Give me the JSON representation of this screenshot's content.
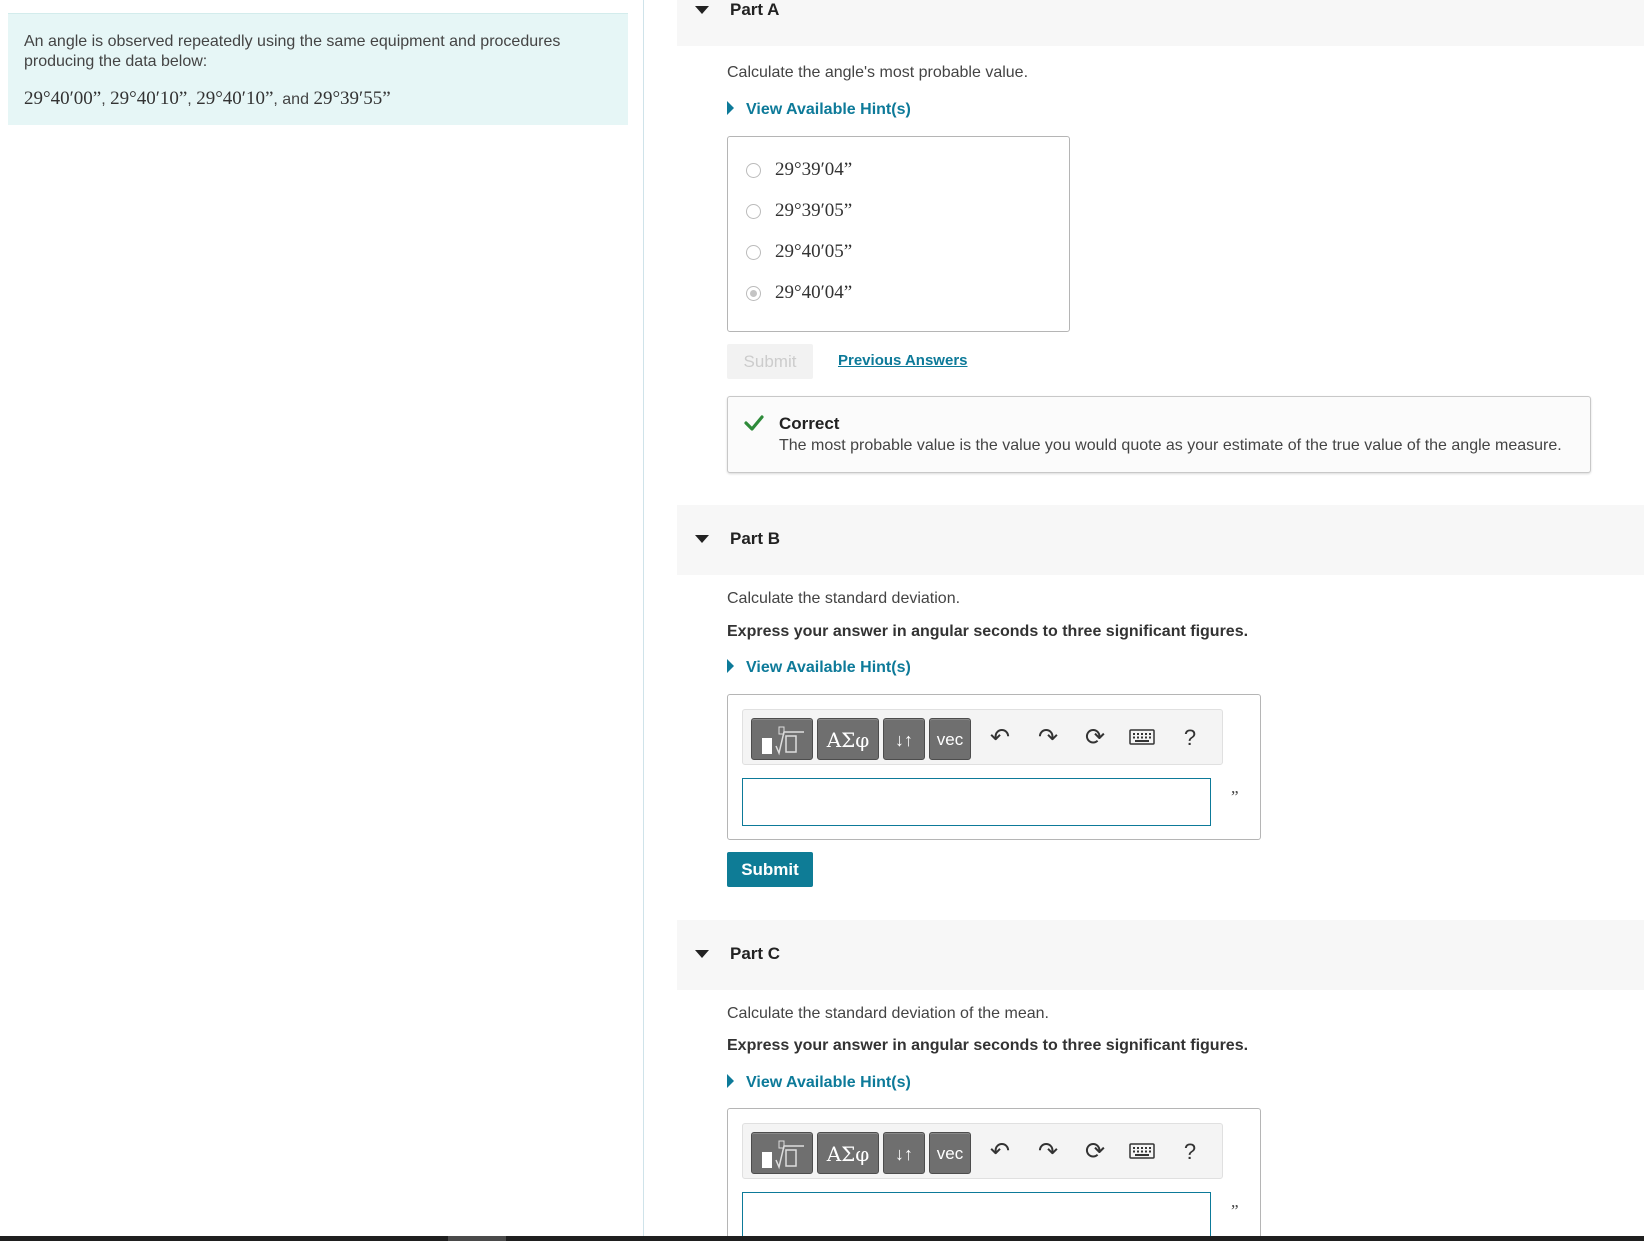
{
  "problem": {
    "intro": "An angle is observed repeatedly using the same equipment and procedures producing the data below:",
    "data_values": [
      "29°40′00”",
      "29°40′10”",
      "29°40′10”",
      "29°39′55”"
    ],
    "sep": ",",
    "and": "and"
  },
  "partA": {
    "title": "Part A",
    "prompt": "Calculate the angle's most probable value.",
    "hint_label": "View Available Hint(s)",
    "choices": [
      {
        "label": "29°39′04”",
        "selected": false
      },
      {
        "label": "29°39′05”",
        "selected": false
      },
      {
        "label": "29°40′05”",
        "selected": false
      },
      {
        "label": "29°40′04”",
        "selected": true
      }
    ],
    "submit_label": "Submit",
    "previous_answers_label": "Previous Answers",
    "feedback_title": "Correct",
    "feedback_text": "The most probable value is the value you would quote as your estimate of the true value of the angle measure."
  },
  "partB": {
    "title": "Part B",
    "prompt": "Calculate the standard deviation.",
    "instruction": "Express your answer in angular seconds to three significant figures.",
    "hint_label": "View Available Hint(s)",
    "unit": "”",
    "submit_label": "Submit"
  },
  "partC": {
    "title": "Part C",
    "prompt": "Calculate the standard deviation of the mean.",
    "instruction": "Express your answer in angular seconds to three significant figures.",
    "hint_label": "View Available Hint(s)",
    "unit": "”"
  },
  "toolbar": {
    "templates_icon": "templates-icon",
    "symbols_label": "ΑΣφ",
    "arrows_label": "↓↑",
    "vec_label": "vec",
    "undo_icon": "undo-icon",
    "redo_icon": "redo-icon",
    "reset_icon": "reset-icon",
    "keyboard_icon": "keyboard-icon",
    "help_label": "?"
  },
  "colors": {
    "accent": "#0e7c96",
    "correct": "#2e8b3a",
    "intro_bg": "#e6f6f6"
  }
}
